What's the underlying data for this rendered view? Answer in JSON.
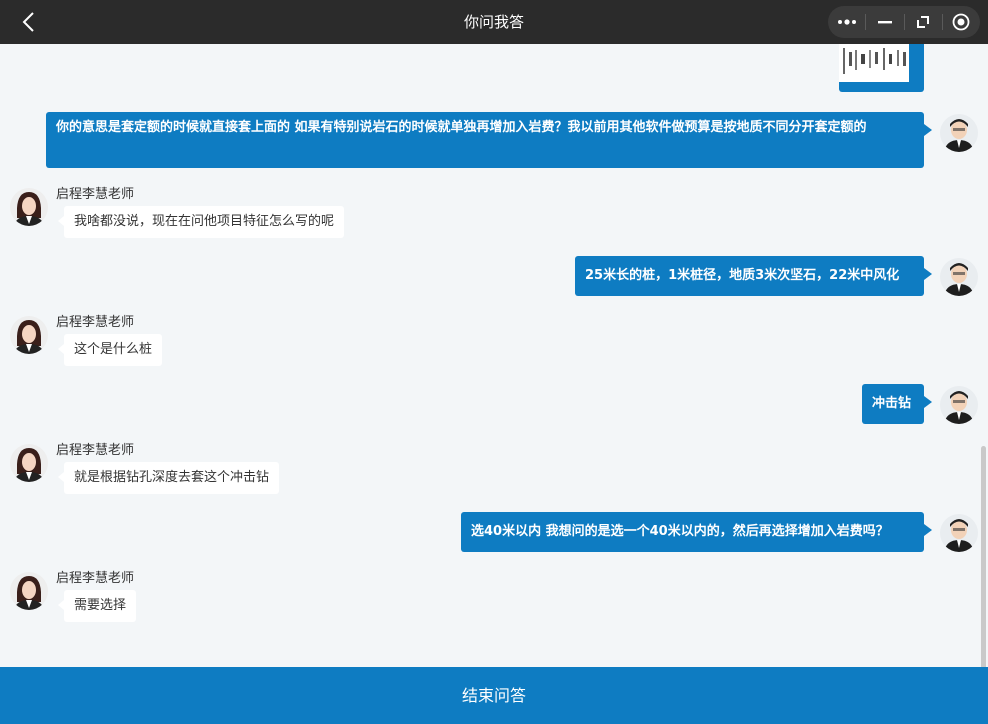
{
  "header": {
    "title": "你问我答"
  },
  "messages": [
    {
      "side": "right",
      "text": "你的意思是套定额的时候就直接套上面的 如果有特别说岩石的时候就单独再增加入岩费？我以前用其他软件做预算是按地质不同分开套定额的"
    },
    {
      "side": "left",
      "sender": "启程李慧老师",
      "text": "我啥都没说，现在在问他项目特征怎么写的呢"
    },
    {
      "side": "right",
      "text": "25米长的桩，1米桩径，地质3米次坚石，22米中风化"
    },
    {
      "side": "left",
      "sender": "启程李慧老师",
      "text": "这个是什么桩"
    },
    {
      "side": "right",
      "text": "冲击钻"
    },
    {
      "side": "left",
      "sender": "启程李慧老师",
      "text": "就是根据钻孔深度去套这个冲击钻"
    },
    {
      "side": "right",
      "text": "选40米以内 我想问的是选一个40米以内的，然后再选择增加入岩费吗？"
    },
    {
      "side": "left",
      "sender": "启程李慧老师",
      "text": "需要选择"
    }
  ],
  "footer": {
    "end_label": "结束问答"
  }
}
